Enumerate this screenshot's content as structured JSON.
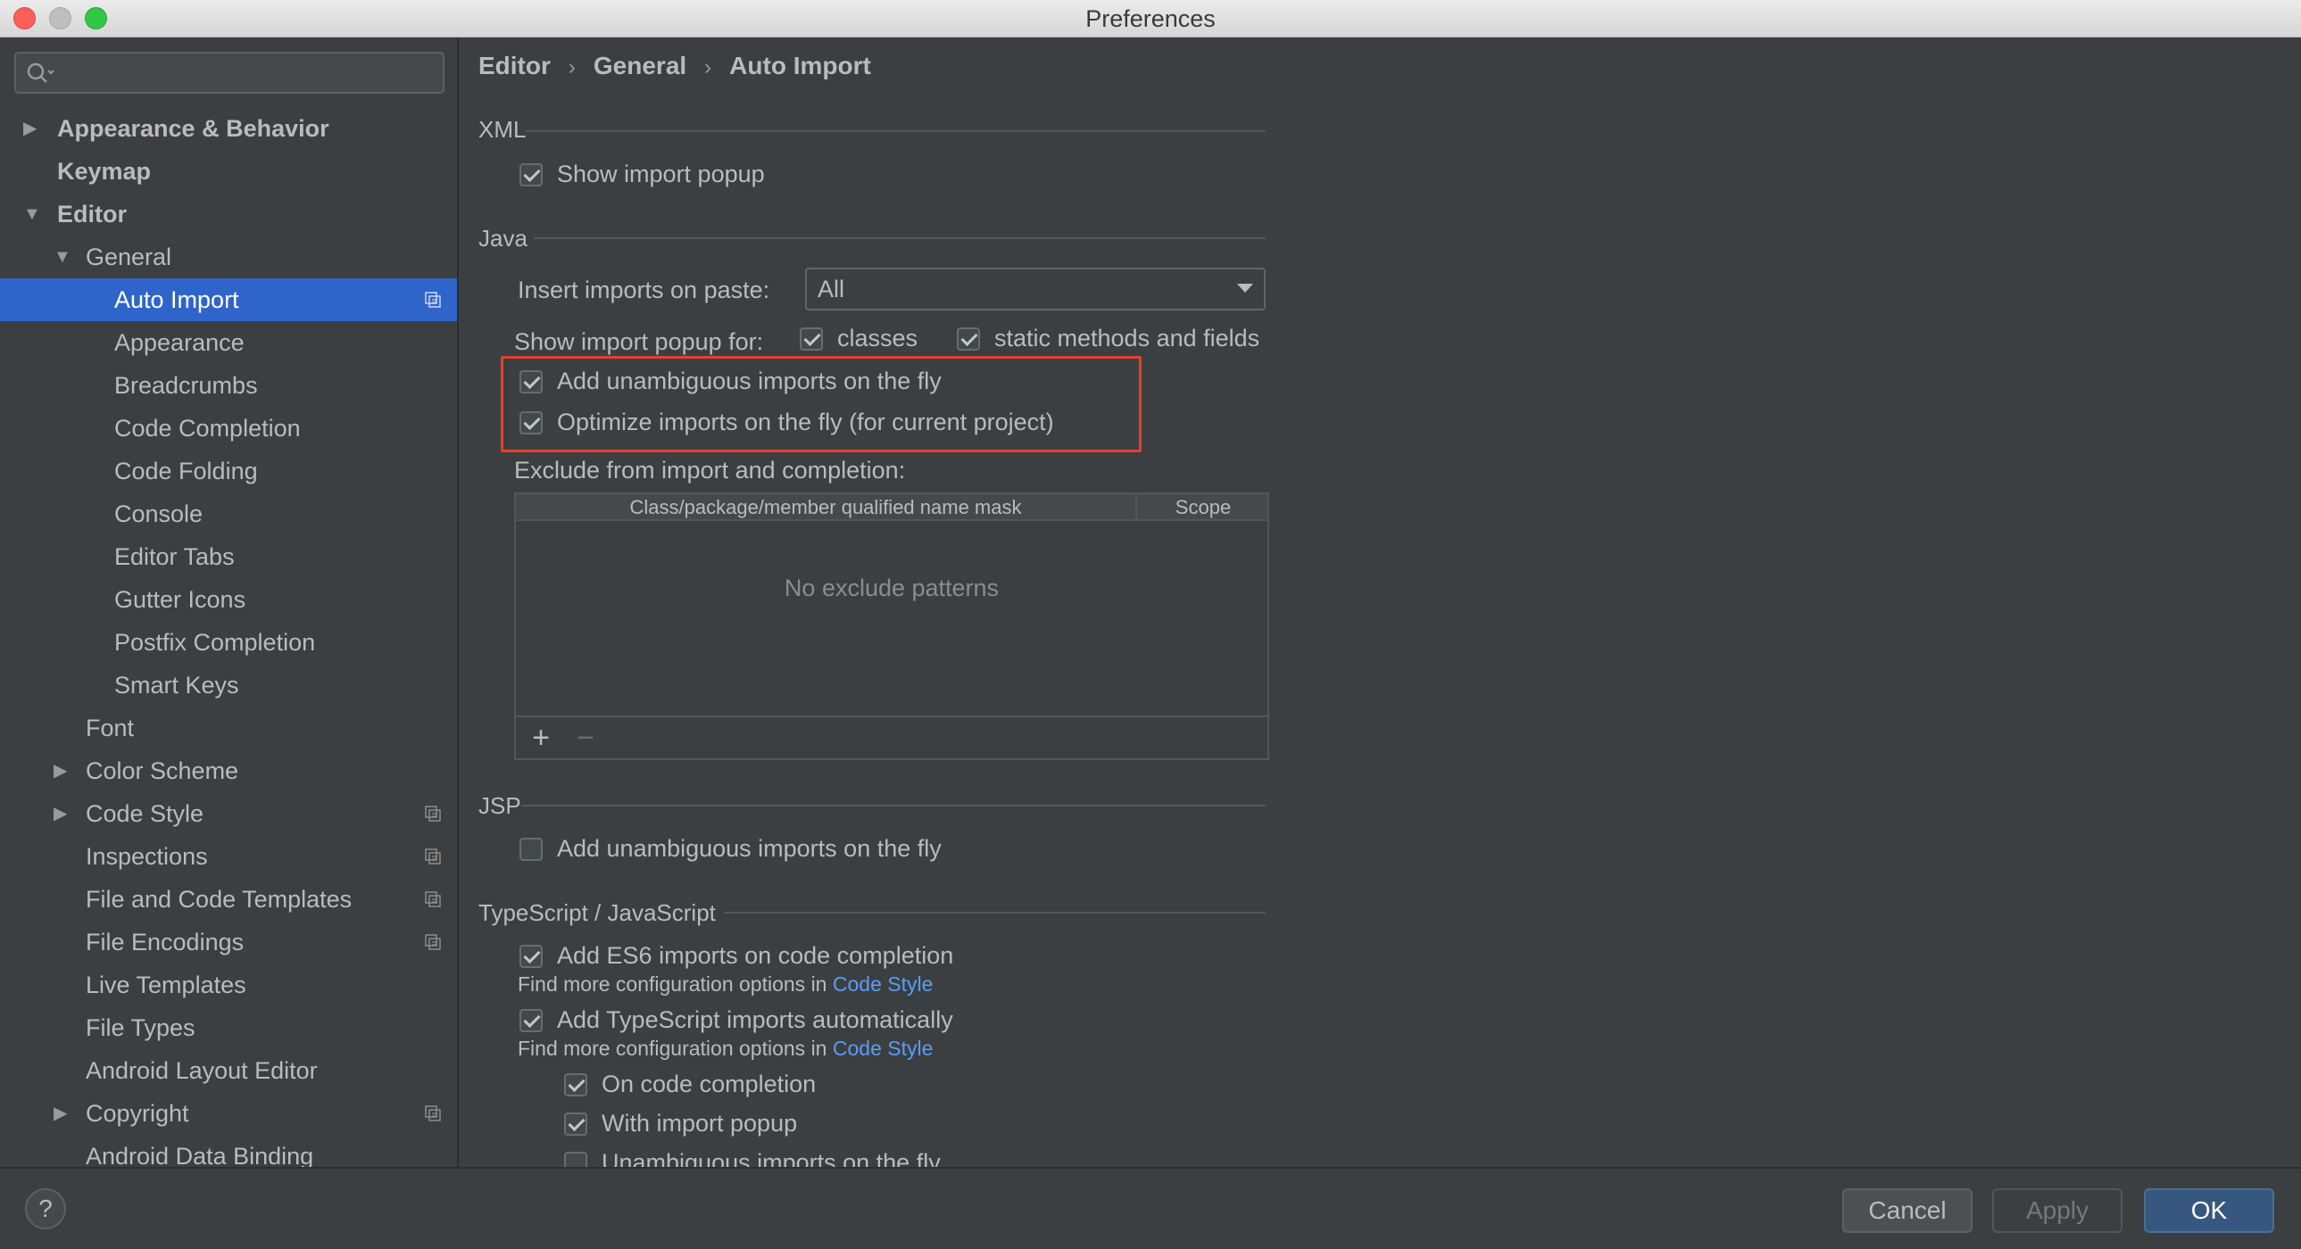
{
  "window": {
    "title": "Preferences"
  },
  "sidebar": {
    "search": {
      "placeholder": ""
    },
    "items": [
      {
        "label": "Appearance & Behavior",
        "bold": true,
        "level": 0,
        "arrow": "right"
      },
      {
        "label": "Keymap",
        "bold": true,
        "level": 0,
        "arrow": ""
      },
      {
        "label": "Editor",
        "bold": true,
        "level": 0,
        "arrow": "down"
      },
      {
        "label": "General",
        "bold": false,
        "level": 1,
        "arrow": "down"
      },
      {
        "label": "Auto Import",
        "bold": false,
        "level": 2,
        "arrow": "",
        "selected": true,
        "project": true
      },
      {
        "label": "Appearance",
        "bold": false,
        "level": 2,
        "arrow": ""
      },
      {
        "label": "Breadcrumbs",
        "bold": false,
        "level": 2,
        "arrow": ""
      },
      {
        "label": "Code Completion",
        "bold": false,
        "level": 2,
        "arrow": ""
      },
      {
        "label": "Code Folding",
        "bold": false,
        "level": 2,
        "arrow": ""
      },
      {
        "label": "Console",
        "bold": false,
        "level": 2,
        "arrow": ""
      },
      {
        "label": "Editor Tabs",
        "bold": false,
        "level": 2,
        "arrow": ""
      },
      {
        "label": "Gutter Icons",
        "bold": false,
        "level": 2,
        "arrow": ""
      },
      {
        "label": "Postfix Completion",
        "bold": false,
        "level": 2,
        "arrow": ""
      },
      {
        "label": "Smart Keys",
        "bold": false,
        "level": 2,
        "arrow": ""
      },
      {
        "label": "Font",
        "bold": false,
        "level": 1,
        "arrow": ""
      },
      {
        "label": "Color Scheme",
        "bold": false,
        "level": 1,
        "arrow": "right"
      },
      {
        "label": "Code Style",
        "bold": false,
        "level": 1,
        "arrow": "right",
        "project": true
      },
      {
        "label": "Inspections",
        "bold": false,
        "level": 1,
        "arrow": "",
        "project": true
      },
      {
        "label": "File and Code Templates",
        "bold": false,
        "level": 1,
        "arrow": "",
        "project": true
      },
      {
        "label": "File Encodings",
        "bold": false,
        "level": 1,
        "arrow": "",
        "project": true
      },
      {
        "label": "Live Templates",
        "bold": false,
        "level": 1,
        "arrow": ""
      },
      {
        "label": "File Types",
        "bold": false,
        "level": 1,
        "arrow": ""
      },
      {
        "label": "Android Layout Editor",
        "bold": false,
        "level": 1,
        "arrow": ""
      },
      {
        "label": "Copyright",
        "bold": false,
        "level": 1,
        "arrow": "right",
        "project": true
      },
      {
        "label": "Android Data Binding",
        "bold": false,
        "level": 1,
        "arrow": ""
      }
    ]
  },
  "breadcrumb": [
    "Editor",
    "General",
    "Auto Import"
  ],
  "sections": {
    "xml": {
      "title": "XML",
      "show_import_popup": {
        "label": "Show import popup",
        "checked": true
      }
    },
    "java": {
      "title": "Java",
      "insert_label": "Insert imports on paste:",
      "insert_value": "All",
      "show_popup_label": "Show import popup for:",
      "classes": {
        "label": "classes",
        "checked": true
      },
      "static_methods": {
        "label": "static methods and fields",
        "checked": true
      },
      "add_unambiguous": {
        "label": "Add unambiguous imports on the fly",
        "checked": true
      },
      "optimize": {
        "label": "Optimize imports on the fly (for current project)",
        "checked": true
      },
      "exclude_label": "Exclude from import and completion:",
      "table": {
        "col_mask": "Class/package/member qualified name mask",
        "col_scope": "Scope",
        "empty": "No exclude patterns",
        "add": "+",
        "remove": "−"
      }
    },
    "jsp": {
      "title": "JSP",
      "add_unambiguous": {
        "label": "Add unambiguous imports on the fly",
        "checked": false
      }
    },
    "ts": {
      "title": "TypeScript / JavaScript",
      "es6": {
        "label": "Add ES6 imports on code completion",
        "checked": true
      },
      "hint1_prefix": "Find more configuration options in",
      "hint1_link": "Code Style",
      "ts_auto": {
        "label": "Add TypeScript imports automatically",
        "checked": true
      },
      "hint2_prefix": "Find more configuration options in",
      "hint2_link": "Code Style",
      "on_completion": {
        "label": "On code completion",
        "checked": true
      },
      "with_popup": {
        "label": "With import popup",
        "checked": true
      },
      "unambiguous": {
        "label": "Unambiguous imports on the fly",
        "checked": false
      }
    }
  },
  "footer": {
    "help": "?",
    "cancel": "Cancel",
    "apply": "Apply",
    "ok": "OK"
  },
  "colors": {
    "background": "#3c3f41",
    "selection": "#2f65ca",
    "link": "#589df6",
    "highlight": "#e5402c",
    "ok_button": "#365880"
  }
}
